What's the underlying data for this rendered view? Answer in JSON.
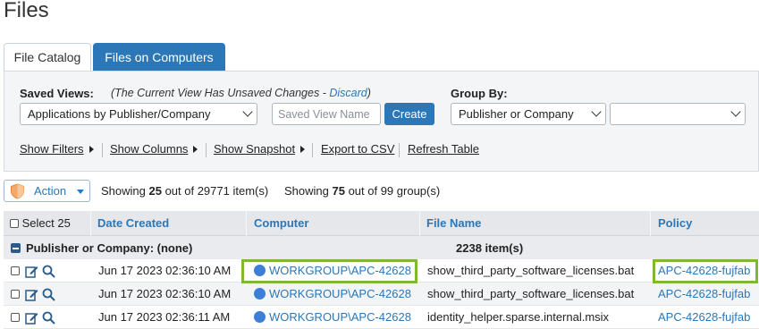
{
  "page": {
    "title": "Files"
  },
  "tabs": [
    {
      "label": "File Catalog",
      "active": false
    },
    {
      "label": "Files on Computers",
      "active": true
    }
  ],
  "filters": {
    "saved_views_label": "Saved Views:",
    "unsaved_prefix": "(The Current View Has Unsaved Changes - ",
    "discard_label": "Discard",
    "unsaved_suffix": ")",
    "saved_view_selected": "Applications by Publisher/Company",
    "saved_view_name_placeholder": "Saved View Name",
    "create_label": "Create",
    "group_by_label": "Group By:",
    "group_by_selected": "Publisher or Company",
    "group_by_secondary": ""
  },
  "toolbar_links": [
    {
      "label": "Show Filters",
      "has_arrow": true
    },
    {
      "label": "Show Columns",
      "has_arrow": true
    },
    {
      "label": "Show Snapshot",
      "has_arrow": true
    },
    {
      "label": "Export to CSV",
      "has_arrow": false
    },
    {
      "label": "Refresh Table",
      "has_arrow": false
    }
  ],
  "action_bar": {
    "action_label": "Action",
    "items_prefix": "Showing ",
    "items_shown": "25",
    "items_mid": " out of ",
    "items_total": "29771",
    "items_suffix": " item(s)",
    "groups_prefix": "Showing ",
    "groups_shown": "75",
    "groups_mid": " out of ",
    "groups_total": "99",
    "groups_suffix": " group(s)"
  },
  "table": {
    "headers": {
      "select": "Select 25",
      "date_created": "Date Created",
      "computer": "Computer",
      "file_name": "File Name",
      "policy": "Policy"
    },
    "group": {
      "label": "Publisher or Company: (none)",
      "count": "2238 item(s)"
    },
    "rows": [
      {
        "date_created": "Jun 17 2023 02:36:10 AM",
        "computer": "WORKGROUP\\APC-42628",
        "file_name": "show_third_party_software_licenses.bat",
        "policy": "APC-42628-fujfab"
      },
      {
        "date_created": "Jun 17 2023 02:36:10 AM",
        "computer": "WORKGROUP\\APC-42628",
        "file_name": "show_third_party_software_licenses.bat",
        "policy": "APC-42628-fujfab"
      },
      {
        "date_created": "Jun 17 2023 02:36:11 AM",
        "computer": "WORKGROUP\\APC-42628",
        "file_name": "identity_helper.sparse.internal.msix",
        "policy": "APC-42628-fujfab"
      }
    ]
  },
  "colors": {
    "accent": "#2b77b8",
    "highlight": "#7dba2f",
    "status_dot": "#3d7fd6"
  }
}
